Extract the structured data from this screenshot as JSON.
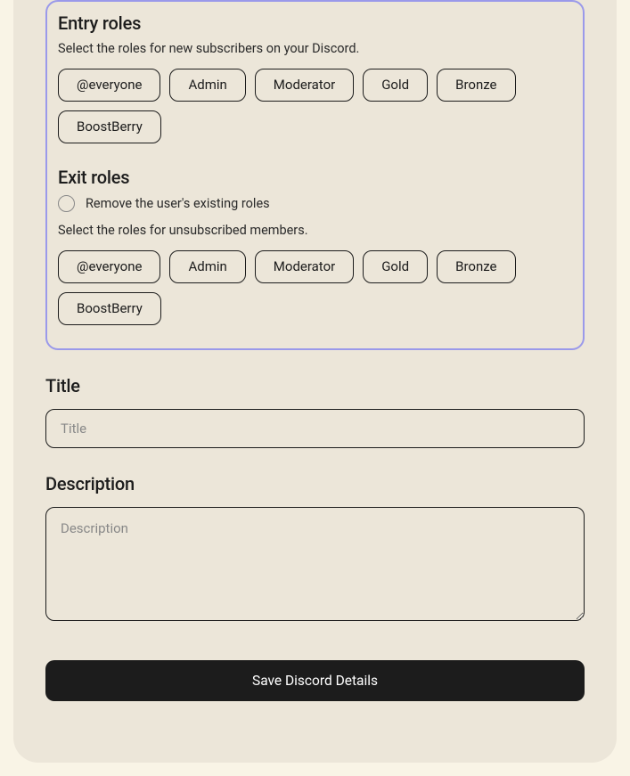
{
  "entry": {
    "title": "Entry roles",
    "description": "Select the roles for new subscribers on your Discord.",
    "roles": [
      "@everyone",
      "Admin",
      "Moderator",
      "Gold",
      "Bronze",
      "BoostBerry"
    ]
  },
  "exit": {
    "title": "Exit roles",
    "remove_label": "Remove the user's existing roles",
    "description": "Select the roles for unsubscribed members.",
    "roles": [
      "@everyone",
      "Admin",
      "Moderator",
      "Gold",
      "Bronze",
      "BoostBerry"
    ]
  },
  "title_field": {
    "label": "Title",
    "placeholder": "Title",
    "value": ""
  },
  "description_field": {
    "label": "Description",
    "placeholder": "Description",
    "value": ""
  },
  "save_button_label": "Save Discord Details"
}
